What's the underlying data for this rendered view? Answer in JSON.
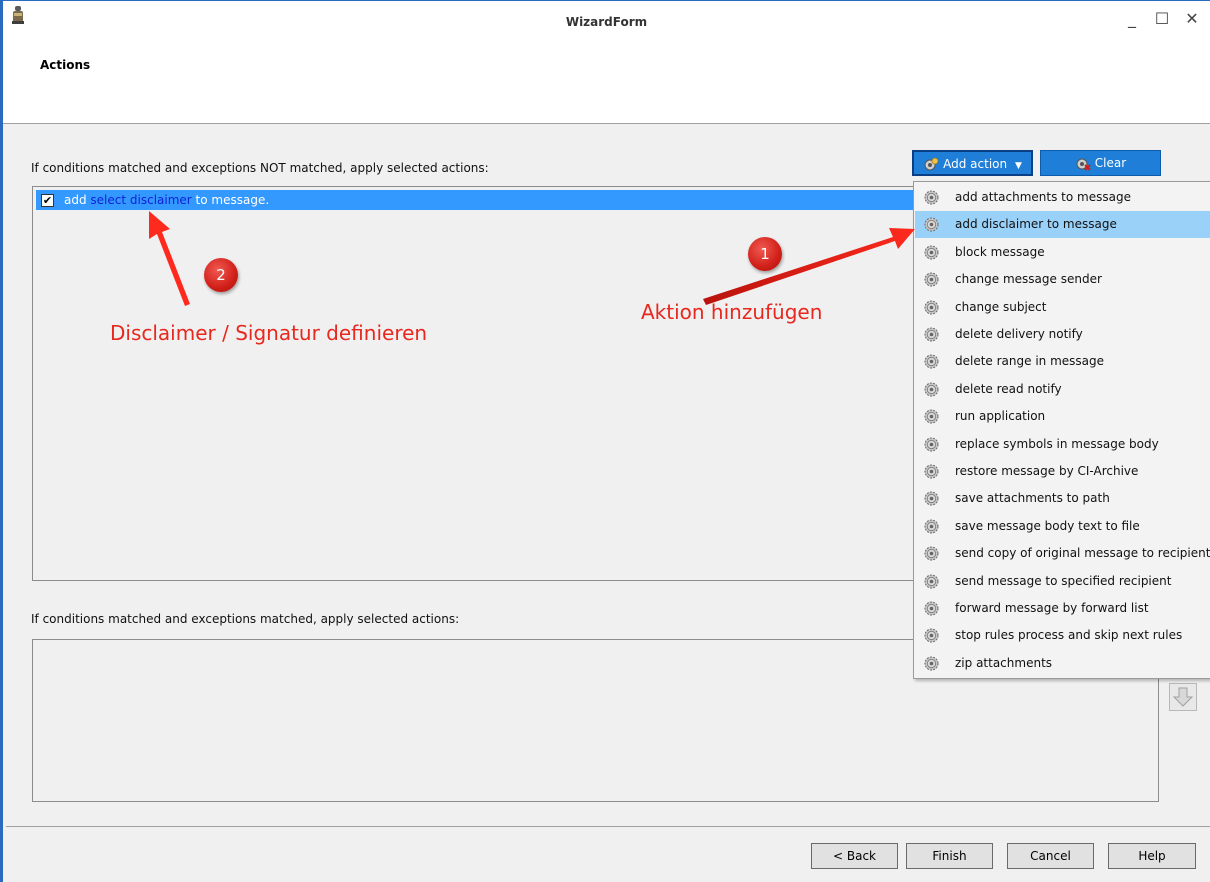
{
  "window": {
    "title": "WizardForm",
    "controls": {
      "minimize": "_",
      "maximize": "☐",
      "close": "✕"
    }
  },
  "header": {
    "page_title": "Actions"
  },
  "section1": {
    "label": "If conditions matched and exceptions NOT matched, apply selected actions:",
    "rows": [
      {
        "prefix": "add",
        "link": "select disclaimer",
        "suffix": "to message.",
        "checked": true
      }
    ]
  },
  "section2": {
    "label": "If conditions matched and exceptions matched, apply selected actions:"
  },
  "toolbar": {
    "add_action_label": "Add action",
    "clear_label": "Clear"
  },
  "dropdown": {
    "items": [
      "add attachments to message",
      "add disclaimer to message",
      "block message",
      "change message sender",
      "change subject",
      "delete delivery notify",
      "delete range in message",
      "delete read notify",
      "run application",
      "replace symbols in message body",
      "restore message by CI-Archive",
      "save attachments to path",
      "save message body text to file",
      "send copy of original message to recipient",
      "send message to specified recipient",
      "forward message by forward list",
      "stop rules process and skip next rules",
      "zip attachments"
    ],
    "selected_index": 1
  },
  "footer": {
    "back_label": "< Back",
    "finish_label": "Finish",
    "cancel_label": "Cancel",
    "help_label": "Help"
  },
  "annotations": {
    "badge1": "1",
    "badge2": "2",
    "text1": "Aktion hinzufügen",
    "text2": "Disclaimer / Signatur definieren",
    "color": "#e8281e"
  }
}
